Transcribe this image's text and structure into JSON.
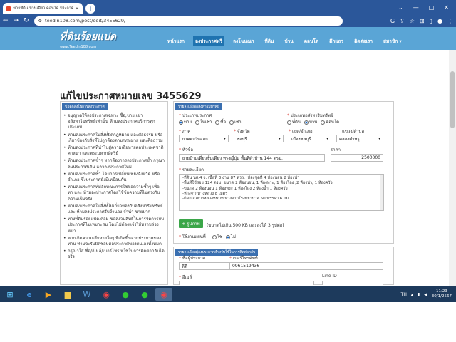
{
  "browser": {
    "tab_title": "ขายที่ดิน บ้านเดี่ยว คอนโด ประกาศฟรี",
    "url": "teedin108.com/post/edit/3455629/"
  },
  "site": {
    "logo_text": "ที่ดินร้อยแปด",
    "logo_sub": "www.Teedin108.com",
    "nav": [
      "หน้าแรก",
      "ลงประกาศฟรี",
      "ลงโฆษณา",
      "ที่ดิน",
      "บ้าน",
      "คอนโด",
      "ตึกแถว",
      "ติดต่อเรา",
      "สมาชิก ▾"
    ]
  },
  "page": {
    "title": "แก้ไขประกาศหมายเลข 3455629"
  },
  "rules": {
    "header": "ข้อตกลงในการลงประกาศ",
    "items": [
      "อนุญาตให้ลงประกาศเฉพาะ ซื้อ,ขาย,เช่า อสังหาริมทรัพย์เท่านั้น ห้ามลงประกาศบริการทุกประเภท",
      "ห้ามลงประกาศในสิ่งที่ผิดกฎหมาย และศีลธรรม หรือเกี่ยวข้องกับสิ่งที่ไม่ถูกต้องตามกฎหมาย และศีลธรรม",
      "ห้ามลงประกาศที่นำไปสู่ความเสียหายต่อประเทศชาติ ศาสนา และพระมหากษัตริย์",
      "ห้ามลงประกาศซ้ำๆ หากต้องการลงประกาศซ้ำ กรุณาลบประกาศเดิม แล้วลงประกาศใหม่",
      "ห้ามลงประกาศซ้ำ โดยการเปลี่ยนเพียงจังหวัด หรือ อำเภอ ซึ่งประกาศยังมีเหมือนกัน",
      "ห้ามลงประกาศที่มีลักษณะการใช้ข้อความซ้ำๆ เพื่อหา และ ห้ามลงประกาศโดยใช้ข้อความที่ไม่ตรงกับความเป็นจริง",
      "ห้ามลงประกาศในสิ่งที่ไม่เกี่ยวข้องกับอสังหาริมทรัพย์ และ ห้ามลงประกาศรับจำนอง จำนำ ขายฝาก",
      "ทางที่ดินร้อยแปด.คอม ขอสงวนสิทธิ์ในการจัดการกับประกาศที่ไม่เหมาะสม โดยไม่ต้องแจ้งให้ทราบล่วงหน้า",
      "หากเกิดความเสียหายใดๆ ที่เกิดขึ้นจากประกาศของท่าน ท่านจะรับผิดชอบต่อประกาศของตนเองทั้งหมด",
      "กรุณาใส่ ชื่อ/อีเมล์/เบอร์โทร ที่ใช้ในการติดต่อกลับได้จริง"
    ]
  },
  "property": {
    "header": "รายละเอียดอสังหาริมทรัพย์",
    "type_label": "ประเภทประกาศ",
    "type_options": [
      "ขาย",
      "ให้เช่า",
      "ซื้อ",
      "เช่า"
    ],
    "type_selected": "ขาย",
    "asset_label": "ประเภทอสังหาริมทรัพย์",
    "asset_options": [
      "ที่ดิน",
      "บ้าน",
      "คอนโด"
    ],
    "asset_selected": "บ้าน",
    "region_label": "ภาค",
    "region_value": "ภาคตะวันออก",
    "province_label": "จังหวัด",
    "province_value": "ชลบุรี",
    "district_label": "เขต/อำเภอ",
    "district_value": "เมืองชลบุรี",
    "subdistrict_label": "แขวง/ตำบล",
    "subdistrict_value": "คลองตำหรุ",
    "subject_label": "หัวข้อ",
    "subject_value": "ขายบ้านเดี่ยวชั้นเดียว ทรงญี่ปุ่น พื้นที่ตัวบ้าน 144 ตรม.",
    "price_label": "ราคา",
    "price_value": "2500000",
    "detail_label": "รายละเอียด",
    "detail_lines": [
      "-ที่ดิน นส.4 จ. เนื้อที่ 3 งาน 87 ตรว.  ห้องชุดที่ 4 ห้องนอน 2 ห้องน้ำ",
      "-พื้นที่ใช้สอย 124 ตรม. ขนาด 2 ห้องนอน, 1 ห้องพระ, 1 ห้องโถง ,2 ห้องน้ำ, 1 ห้องครัว",
      "-ขนาด 2 ห้องนอน 1 ห้องพระ 1 ห้องโถง 2 ห้องน้ำ 1 ห้องครัว",
      "-ห่างจากทางหลวง 8 เมตร",
      "-ติดถนนทางหลวงชนบท ห่างจากโรงพยาบาล 50 พรรษา 6 กม."
    ],
    "upload_label": "+ รูปภาพ",
    "upload_hint": "(ขนาดไม่เกิน 500 KB และลงได้ 3 รูปต่อ)",
    "map_label": "ใช้งานแผนที่",
    "map_options": [
      "ใช่",
      "ไม่"
    ],
    "map_selected": "ไม่"
  },
  "contact": {
    "header": "รายละเอียดผู้ลงประกาศสำหรับใช้ในการติดต่อกลับ",
    "name_label": "ชื่อผู้ประกาศ",
    "name_value": "ดีดี",
    "phone_label": "เบอร์โทรศัพท์",
    "phone_value": "0961519436",
    "email_label": "อีเมล์",
    "line_label": "Line ID"
  },
  "taskbar": {
    "lang": "TH",
    "time": "11:23",
    "date": "30/1/2567"
  }
}
